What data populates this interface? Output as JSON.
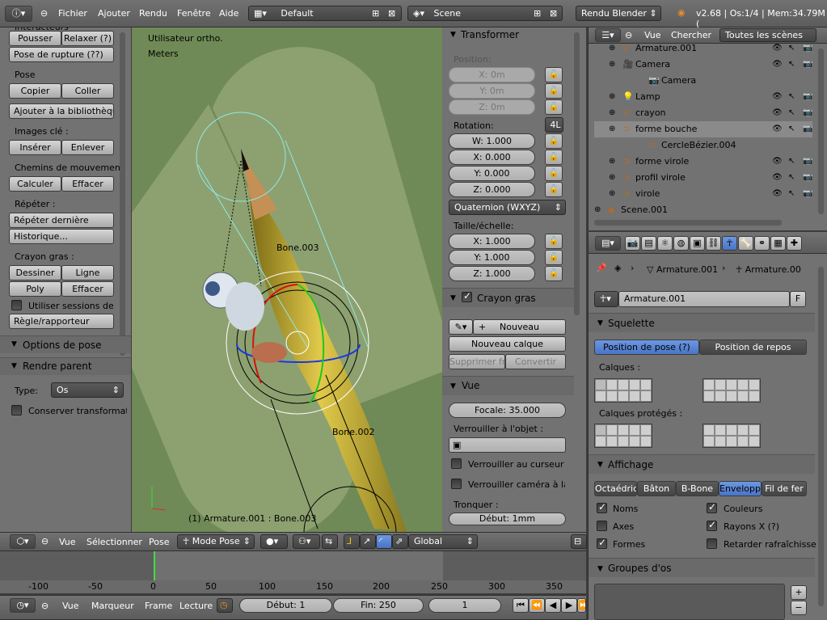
{
  "top": {
    "menus": [
      "Fichier",
      "Ajouter",
      "Rendu",
      "Fenêtre",
      "Aide"
    ],
    "layout": "Default",
    "scene": "Scene",
    "engine": "Rendu Blender",
    "stats": "v2.68 | Os:1/4 | Mem:34.79M ("
  },
  "tool": {
    "top_partial": "Interacteurs",
    "pousser": "Pousser",
    "relaxer": "Relaxer (?)",
    "pose_rupture": "Pose de rupture (??)",
    "pose_title": "Pose",
    "copier": "Copier",
    "coller": "Coller",
    "ajouter_bib": "Ajouter à la bibliothèqu",
    "images_cle": "Images clé",
    "inserer": "Insérer",
    "enlever": "Enlever",
    "chemins": "Chemins de mouvemen",
    "calculer": "Calculer",
    "effacer1": "Effacer",
    "repeter": "Répéter",
    "repeter_derniere": "Répéter dernière",
    "historique": "Historique...",
    "crayon_gras": "Crayon gras",
    "dessiner": "Dessiner",
    "ligne": "Ligne",
    "poly": "Poly",
    "effacer2": "Effacer",
    "sessions": "Utiliser sessions de c",
    "regle": "Règle/rapporteur",
    "options_pose": "Options de pose",
    "rendre_parent": "Rendre parent",
    "type_label": "Type:",
    "type_value": "Os",
    "conserver": "Conserver transformatio"
  },
  "viewport": {
    "view_name": "Utilisateur ortho.",
    "units": "Meters",
    "bone3": "Bone.003",
    "bone2": "Bone.002",
    "status": "(1) Armature.001 : Bone.003"
  },
  "transform": {
    "title": "Transformer",
    "position": "Position:",
    "px": "X: 0m",
    "py": "Y: 0m",
    "pz": "Z: 0m",
    "rotation": "Rotation:",
    "mode_4l": "4L",
    "w": "W: 1.000",
    "x": "X: 0.000",
    "y": "Y: 0.000",
    "z": "Z: 0.000",
    "rot_mode": "Quaternion (WXYZ)",
    "scale": "Taille/échelle:",
    "sx": "X: 1.000",
    "sy": "Y: 1.000",
    "sz": "Z: 1.000",
    "crayon_gras": "Crayon gras",
    "nouveau": "Nouveau",
    "nouveau_calque": "Nouveau calque",
    "supprimer": "Supprimer fra",
    "convertir": "Convertir",
    "vue": "Vue",
    "focale": "Focale: 35.000",
    "verrouiller_objet": "Verrouiller à l'objet  :",
    "verrouiller_curseur": "Verrouiller au curseur",
    "verrouiller_camera": "Verrouiller caméra à la",
    "tronquer": "Tronquer  :",
    "debut": "Début: 1mm"
  },
  "outliner": {
    "vue": "Vue",
    "chercher": "Chercher",
    "filter": "Toutes les scènes",
    "items": [
      {
        "name": "Armature.001",
        "indent": 0
      },
      {
        "name": "Camera",
        "indent": 0
      },
      {
        "name": "Camera",
        "indent": 1
      },
      {
        "name": "Lamp",
        "indent": 0
      },
      {
        "name": "crayon",
        "indent": 0
      },
      {
        "name": "forme bouche",
        "indent": 0
      },
      {
        "name": "CercleBézier.004",
        "indent": 1
      },
      {
        "name": "forme virole",
        "indent": 0
      },
      {
        "name": "profil virole",
        "indent": 0
      },
      {
        "name": "virole",
        "indent": 0
      },
      {
        "name": "Scene.001",
        "indent": -1
      }
    ]
  },
  "props": {
    "crumb1": "Armature.001",
    "crumb2": "Armature.00",
    "datablock": "Armature.001",
    "fake": "F",
    "squelette": "Squelette",
    "position_pose": "Position de pose (?)",
    "position_repos": "Position de repos",
    "calques": "Calques  :",
    "calques_proteges": "Calques protégés  :",
    "affichage": "Affichage",
    "disp": [
      "Octaédriq",
      "Bâton",
      "B-Bone",
      "Enveloppe",
      "Fil de fer"
    ],
    "noms": "Noms",
    "couleurs": "Couleurs",
    "axes": "Axes",
    "rayons": "Rayons X (?)",
    "formes": "Formes",
    "retarder": "Retarder rafraîchisse",
    "groupes": "Groupes d'os"
  },
  "view3d_header": {
    "vue": "Vue",
    "selectionner": "Sélectionner",
    "pose": "Pose",
    "mode": "Mode Pose",
    "orientation": "Global"
  },
  "timeline": {
    "ticks": [
      "-100",
      "-50",
      "0",
      "50",
      "100",
      "150",
      "200",
      "250",
      "300",
      "350"
    ],
    "vue": "Vue",
    "marqueur": "Marqueur",
    "frame": "Frame",
    "lecture": "Lecture",
    "debut": "Début: 1",
    "fin": "Fin: 250",
    "current": "1"
  }
}
